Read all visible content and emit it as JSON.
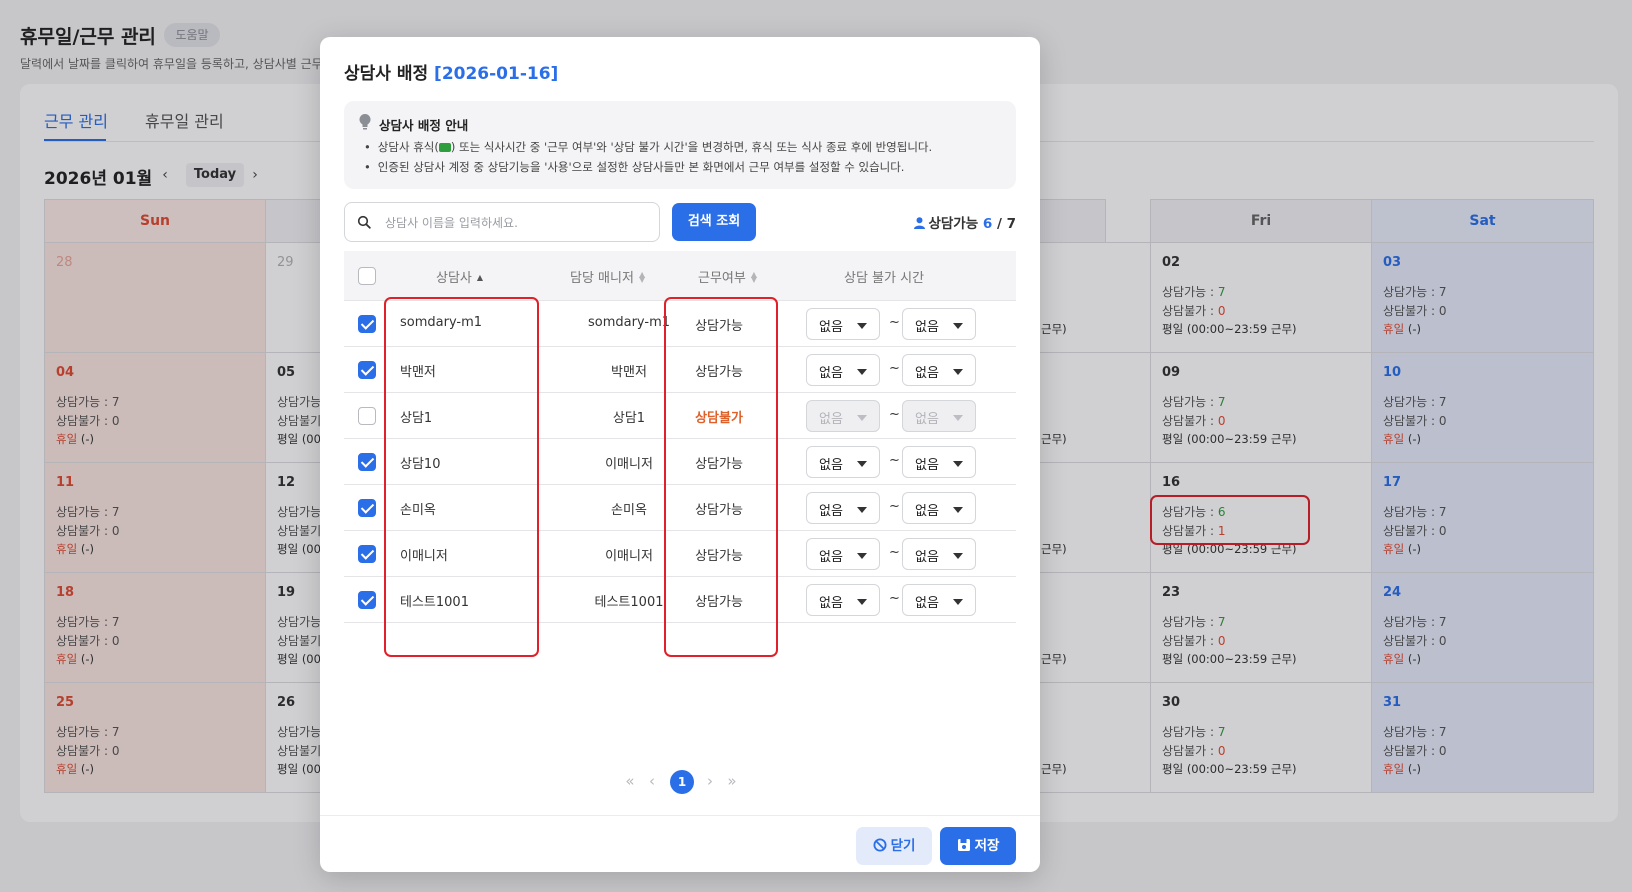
{
  "page": {
    "title": "휴무일/근무 관리",
    "help_badge": "도움말",
    "description": "달력에서 날짜를 클릭하여 휴무일을 등록하고, 상담사별 근무"
  },
  "tabs": [
    {
      "label": "근무 관리",
      "active": true
    },
    {
      "label": "휴무일 관리",
      "active": false
    }
  ],
  "calendar": {
    "month_label": "2026년 01월",
    "today_label": "Today",
    "weekday_headers": {
      "sun": "Sun",
      "thu_partial": "hu",
      "fri": "Fri",
      "sat": "Sat"
    },
    "sun_column": [
      {
        "day": "28",
        "prev_month": true
      },
      {
        "day": "04",
        "l1_label": "상담가능 : ",
        "l1_val": "7",
        "l2_label": "상담불가 : ",
        "l2_val": "0",
        "l3_label": "휴일",
        "l3_val": " (-)"
      },
      {
        "day": "11",
        "l1_label": "상담가능 : ",
        "l1_val": "7",
        "l2_label": "상담불가 : ",
        "l2_val": "0",
        "l3_label": "휴일",
        "l3_val": " (-)"
      },
      {
        "day": "18",
        "l1_label": "상담가능 : ",
        "l1_val": "7",
        "l2_label": "상담불가 : ",
        "l2_val": "0",
        "l3_label": "휴일",
        "l3_val": " (-)"
      },
      {
        "day": "25",
        "l1_label": "상담가능 : ",
        "l1_val": "7",
        "l2_label": "상담불가 : ",
        "l2_val": "0",
        "l3_label": "휴일",
        "l3_val": " (-)"
      }
    ],
    "mon_column": [
      {
        "day": "29",
        "prev_month": true
      },
      {
        "day": "05",
        "l1": "상담가능",
        "l2": "상담불기",
        "l3": "평일 (00"
      },
      {
        "day": "12",
        "l1": "상담가능",
        "l2": "상담불기",
        "l3": "평일 (00"
      },
      {
        "day": "19",
        "l1": "상담가능",
        "l2": "상담불기",
        "l3": "평일 (00"
      },
      {
        "day": "26",
        "l1": "상담가능",
        "l2": "상담불기",
        "l3": "평일 (00"
      }
    ],
    "thu_tail_text": "근무)",
    "fri_column": [
      {
        "day": "02",
        "l1_label": "상담가능 : ",
        "l1_val": "7",
        "l2_label": "상담불가 : ",
        "l2_val": "0",
        "l3": "평일 (00:00~23:59 근무)"
      },
      {
        "day": "09",
        "l1_label": "상담가능 : ",
        "l1_val": "7",
        "l2_label": "상담불가 : ",
        "l2_val": "0",
        "l3": "평일 (00:00~23:59 근무)"
      },
      {
        "day": "16",
        "l1_label": "상담가능 : ",
        "l1_val": "6",
        "l2_label": "상담불가 : ",
        "l2_val": "1",
        "l3": "평일 (00:00~23:59 근무)"
      },
      {
        "day": "23",
        "l1_label": "상담가능 : ",
        "l1_val": "7",
        "l2_label": "상담불가 : ",
        "l2_val": "0",
        "l3": "평일 (00:00~23:59 근무)"
      },
      {
        "day": "30",
        "l1_label": "상담가능 : ",
        "l1_val": "7",
        "l2_label": "상담불가 : ",
        "l2_val": "0",
        "l3": "평일 (00:00~23:59 근무)"
      }
    ],
    "sat_column": [
      {
        "day": "03",
        "l1_label": "상담가능 : ",
        "l1_val": "7",
        "l2_label": "상담불가 : ",
        "l2_val": "0",
        "l3_label": "휴일",
        "l3_val": " (-)"
      },
      {
        "day": "10",
        "l1_label": "상담가능 : ",
        "l1_val": "7",
        "l2_label": "상담불가 : ",
        "l2_val": "0",
        "l3_label": "휴일",
        "l3_val": " (-)"
      },
      {
        "day": "17",
        "l1_label": "상담가능 : ",
        "l1_val": "7",
        "l2_label": "상담불가 : ",
        "l2_val": "0",
        "l3_label": "휴일",
        "l3_val": " (-)"
      },
      {
        "day": "24",
        "l1_label": "상담가능 : ",
        "l1_val": "7",
        "l2_label": "상담불가 : ",
        "l2_val": "0",
        "l3_label": "휴일",
        "l3_val": " (-)"
      },
      {
        "day": "31",
        "l1_label": "상담가능 : ",
        "l1_val": "7",
        "l2_label": "상담불가 : ",
        "l2_val": "0",
        "l3_label": "휴일",
        "l3_val": " (-)"
      }
    ]
  },
  "modal": {
    "title_prefix": "상담사 배정 ",
    "title_date": "[2026-01-16]",
    "info": {
      "title": "상담사 배정 안내",
      "line1_a": "상담사 휴식(",
      "line1_b": ") 또는 식사시간 중 '근무 여부'와 '상담 불가 시간'을 변경하면, 휴식 또는 식사 종료 후에 반영됩니다.",
      "line2": "인증된 상담사 계정 중 상담기능을 '사용'으로 설정한 상담사들만 본 화면에서 근무 여부를 설정할 수 있습니다."
    },
    "search": {
      "placeholder": "상담사 이름을 입력하세요.",
      "value": "",
      "button_label": "검색 조회"
    },
    "availability": {
      "label": "상담가능 ",
      "available": "6",
      "separator": " / ",
      "total": "7"
    },
    "table": {
      "headers": {
        "counselor": "상담사",
        "manager": "담당 매니저",
        "work": "근무여부",
        "unavailable_time": "상담 불가 시간"
      },
      "rows": [
        {
          "checked": true,
          "name": "somdary-m1",
          "manager": "somdary-m1",
          "work": "상담가능",
          "from": "없음",
          "to": "없음",
          "disabled": false
        },
        {
          "checked": true,
          "name": "박맨저",
          "manager": "박맨저",
          "work": "상담가능",
          "from": "없음",
          "to": "없음",
          "disabled": false
        },
        {
          "checked": false,
          "name": "상담1",
          "manager": "상담1",
          "work": "상담불가",
          "from": "없음",
          "to": "없음",
          "disabled": true
        },
        {
          "checked": true,
          "name": "상담10",
          "manager": "이매니저",
          "work": "상담가능",
          "from": "없음",
          "to": "없음",
          "disabled": false
        },
        {
          "checked": true,
          "name": "손미옥",
          "manager": "손미옥",
          "work": "상담가능",
          "from": "없음",
          "to": "없음",
          "disabled": false
        },
        {
          "checked": true,
          "name": "이매니저",
          "manager": "이매니저",
          "work": "상담가능",
          "from": "없음",
          "to": "없음",
          "disabled": false
        },
        {
          "checked": true,
          "name": "테스트1001",
          "manager": "테스트1001",
          "work": "상담가능",
          "from": "없음",
          "to": "없음",
          "disabled": false
        }
      ],
      "range_separator": "~"
    },
    "pagination": {
      "first": "«",
      "prev": "‹",
      "current": "1",
      "next": "›",
      "last": "»"
    },
    "buttons": {
      "close": "닫기",
      "save": "저장"
    }
  },
  "colors": {
    "accent": "#2a6ee8",
    "highlight": "#e0202a",
    "available": "#2e9d3e",
    "unavailable": "#e04a32"
  }
}
